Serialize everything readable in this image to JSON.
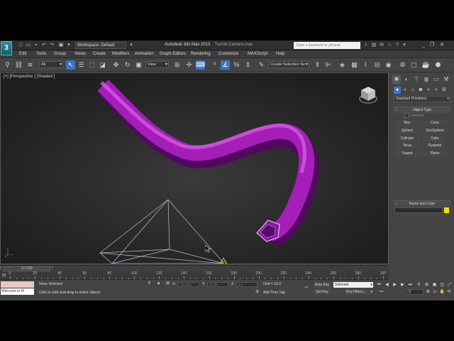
{
  "title_bar": {
    "logo_text": "3",
    "workspace_label": "Workspace: Default",
    "app_title": "Autodesk 3ds Max 2013",
    "file_name": "Tunnel Camera.max",
    "search_placeholder": "Type a keyword or phrase"
  },
  "menu": [
    "Edit",
    "Tools",
    "Group",
    "Views",
    "Create",
    "Modifiers",
    "Animation",
    "Graph Editors",
    "Rendering",
    "Customize",
    "MAXScript",
    "Help"
  ],
  "toolbar": {
    "selection_filter": "All",
    "reference_coord": "View",
    "named_selection_placeholder": "Create Selection Se"
  },
  "viewport": {
    "label": "[+] [Perspective ] [Shaded ]",
    "tube_color": "#a51eb8",
    "camera_line_color": "#b4c8d0"
  },
  "command_panel": {
    "category_dropdown": "Standard Primitives",
    "object_type_header": "Object Type",
    "autogrid_label": "AutoGrid",
    "buttons": [
      "Box",
      "Cone",
      "Sphere",
      "GeoSphere",
      "Cylinder",
      "Tube",
      "Torus",
      "Pyramid",
      "Teapot",
      "Plane"
    ],
    "name_color_header": "Name and Color",
    "object_color": "#ece000"
  },
  "timeline": {
    "current_frame": "0 / 100",
    "ticks": [
      "0",
      "20",
      "40",
      "60",
      "80",
      "100",
      "120",
      "140",
      "160",
      "180",
      "200",
      "220",
      "240",
      "260",
      "280",
      "300"
    ]
  },
  "status": {
    "maxscript_welcome": "Welcome to M",
    "selection_status": "None Selected",
    "prompt": "Click or click-and-drag to select objects",
    "x_label": "X:",
    "x_value": "-71.184",
    "y_label": "Y:",
    "y_value": "47.62",
    "z_label": "Z:",
    "z_value": "0.0",
    "grid": "Grid = 10.0",
    "add_time_tag": "Add Time Tag",
    "auto_key": "Auto Key",
    "set_key": "Set Key",
    "selected_dropdown": "Selected",
    "key_filters": "Key Filters...",
    "frame_value": "0"
  }
}
